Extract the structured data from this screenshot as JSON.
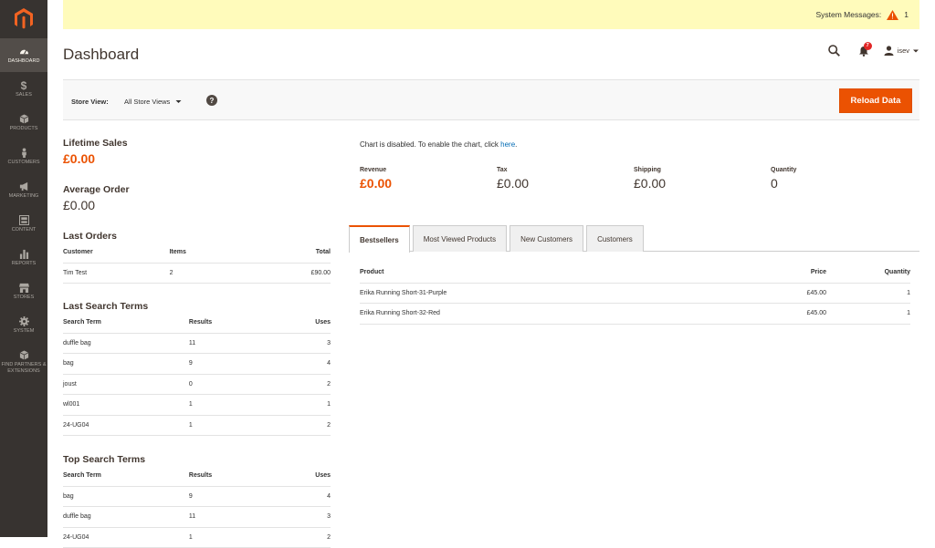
{
  "system_bar": {
    "label": "System Messages:",
    "count": "1"
  },
  "page_title": "Dashboard",
  "header": {
    "notifications_count": "7",
    "user_name": "isev"
  },
  "sidebar": {
    "items": [
      {
        "label": "DASHBOARD"
      },
      {
        "label": "SALES"
      },
      {
        "label": "PRODUCTS"
      },
      {
        "label": "CUSTOMERS"
      },
      {
        "label": "MARKETING"
      },
      {
        "label": "CONTENT"
      },
      {
        "label": "REPORTS"
      },
      {
        "label": "STORES"
      },
      {
        "label": "SYSTEM"
      },
      {
        "label": "FIND PARTNERS & EXTENSIONS"
      }
    ]
  },
  "store_view": {
    "label": "Store View:",
    "selected": "All Store Views",
    "help": "?"
  },
  "reload_label": "Reload Data",
  "lifetime_sales": {
    "label": "Lifetime Sales",
    "value": "£0.00"
  },
  "average_order": {
    "label": "Average Order",
    "value": "£0.00"
  },
  "last_orders": {
    "title": "Last Orders",
    "columns": [
      "Customer",
      "Items",
      "Total"
    ],
    "rows": [
      [
        "Tim Test",
        "2",
        "£90.00"
      ]
    ]
  },
  "last_search_terms": {
    "title": "Last Search Terms",
    "columns": [
      "Search Term",
      "Results",
      "Uses"
    ],
    "rows": [
      [
        "duffle bag",
        "11",
        "3"
      ],
      [
        "bag",
        "9",
        "4"
      ],
      [
        "joust",
        "0",
        "2"
      ],
      [
        "wl001",
        "1",
        "1"
      ],
      [
        "24-UG04",
        "1",
        "2"
      ]
    ]
  },
  "top_search_terms": {
    "title": "Top Search Terms",
    "columns": [
      "Search Term",
      "Results",
      "Uses"
    ],
    "rows": [
      [
        "bag",
        "9",
        "4"
      ],
      [
        "duffle bag",
        "11",
        "3"
      ],
      [
        "24-UG04",
        "1",
        "2"
      ]
    ]
  },
  "chart_message": {
    "text": "Chart is disabled. To enable the chart, click ",
    "link": "here",
    "suffix": "."
  },
  "totals": [
    {
      "label": "Revenue",
      "value": "£0.00"
    },
    {
      "label": "Tax",
      "value": "£0.00"
    },
    {
      "label": "Shipping",
      "value": "£0.00"
    },
    {
      "label": "Quantity",
      "value": "0"
    }
  ],
  "tabs": [
    {
      "label": "Bestsellers"
    },
    {
      "label": "Most Viewed Products"
    },
    {
      "label": "New Customers"
    },
    {
      "label": "Customers"
    }
  ],
  "bestsellers": {
    "columns": [
      "Product",
      "Price",
      "Quantity"
    ],
    "rows": [
      [
        "Erika Running Short-31-Purple",
        "£45.00",
        "1"
      ],
      [
        "Erika Running Short-32-Red",
        "£45.00",
        "1"
      ]
    ]
  },
  "colors": {
    "accent": "#eb5202",
    "sidebar": "#373330",
    "system_bar": "#fffbbb"
  }
}
